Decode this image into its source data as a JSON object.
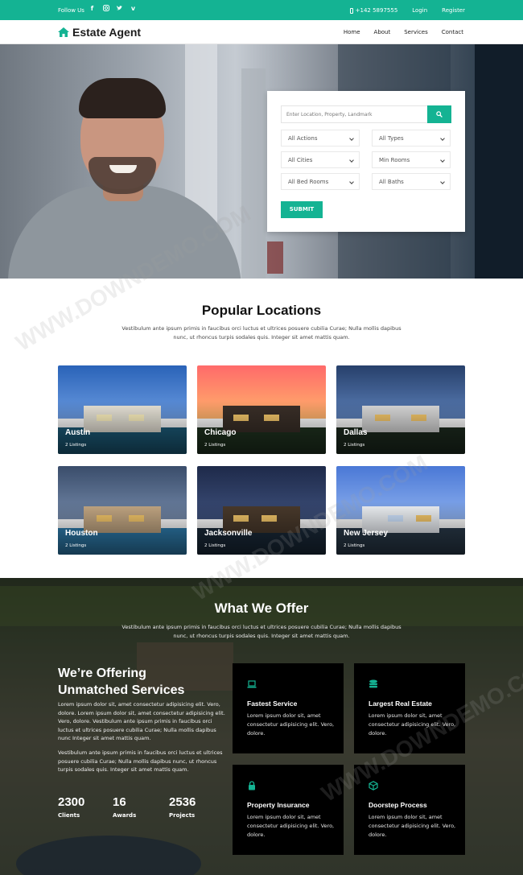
{
  "topbar": {
    "follow": "Follow Us",
    "socials": [
      "facebook-icon",
      "instagram-icon",
      "twitter-icon",
      "vimeo-icon"
    ],
    "phone": "+142 5897555",
    "login": "Login",
    "register": "Register"
  },
  "brand": {
    "name": "Estate Agent",
    "icon": "home-icon"
  },
  "nav": {
    "items": [
      "Home",
      "About",
      "Services",
      "Contact"
    ]
  },
  "search": {
    "placeholder": "Enter Location, Property, Landmark",
    "actions": "All Actions",
    "types": "All Types",
    "cities": "All Cities",
    "rooms": "Min Rooms",
    "bedrooms": "All Bed Rooms",
    "baths": "All Baths",
    "submit": "SUBMIT"
  },
  "locations": {
    "title": "Popular Locations",
    "subtitle": "Vestibulum ante ipsum primis in faucibus orci luctus et ultrices posuere cubilia Curae; Nulla mollis dapibus nunc, ut rhoncus turpis sodales quis. Integer sit amet mattis quam.",
    "cards": [
      {
        "city": "Austin",
        "count": "2 Listings"
      },
      {
        "city": "Chicago",
        "count": "2 Listings"
      },
      {
        "city": "Dallas",
        "count": "2 Listings"
      },
      {
        "city": "Houston",
        "count": "2 Listings"
      },
      {
        "city": "Jacksonville",
        "count": "2 Listings"
      },
      {
        "city": "New Jersey",
        "count": "2 Listings"
      }
    ]
  },
  "offer": {
    "title": "What We Offer",
    "subtitle": "Vestibulum ante ipsum primis in faucibus orci luctus et ultrices posuere cubilia Curae; Nulla mollis dapibus nunc, ut rhoncus turpis sodales quis. Integer sit amet mattis quam.",
    "heading": "We’re Offering Unmatched Services",
    "para1": "Lorem ipsum dolor sit, amet consectetur adipisicing elit. Vero, dolore. Lorem ipsum dolor sit, amet consectetur adipisicing elit. Vero, dolore. Vestibulum ante ipsum primis in faucibus orci luctus et ultrices posuere cubilia Curae; Nulla mollis dapibus nunc Integer sit amet mattis quam.",
    "para2": "Vestibulum ante ipsum primis in faucibus orci luctus et ultrices posuere cubilia Curae; Nulla mollis dapibus nunc, ut rhoncus turpis sodales quis. Integer sit amet mattis quam.",
    "stats": [
      {
        "value": "2300",
        "label": "Clients"
      },
      {
        "value": "16",
        "label": "Awards"
      },
      {
        "value": "2536",
        "label": "Projects"
      }
    ],
    "services": [
      {
        "name": "Fastest Service",
        "desc": "Lorem ipsum dolor sit, amet consectetur adipisicing elit. Vero, dolore.",
        "icon": "laptop-icon"
      },
      {
        "name": "Largest Real Estate",
        "desc": "Lorem ipsum dolor sit, amet consectetur adipisicing elit. Vero, dolore.",
        "icon": "database-icon"
      },
      {
        "name": "Property Insurance",
        "desc": "Lorem ipsum dolor sit, amet consectetur adipisicing elit. Vero, dolore.",
        "icon": "lock-icon"
      },
      {
        "name": "Doorstep Process",
        "desc": "Lorem ipsum dolor sit, amet consectetur adipisicing elit. Vero, dolore.",
        "icon": "cube-icon"
      }
    ]
  },
  "watermark": "WWW.DOWNDEMO.COM",
  "colors": {
    "accent": "#14b393",
    "dark": "#000000"
  }
}
